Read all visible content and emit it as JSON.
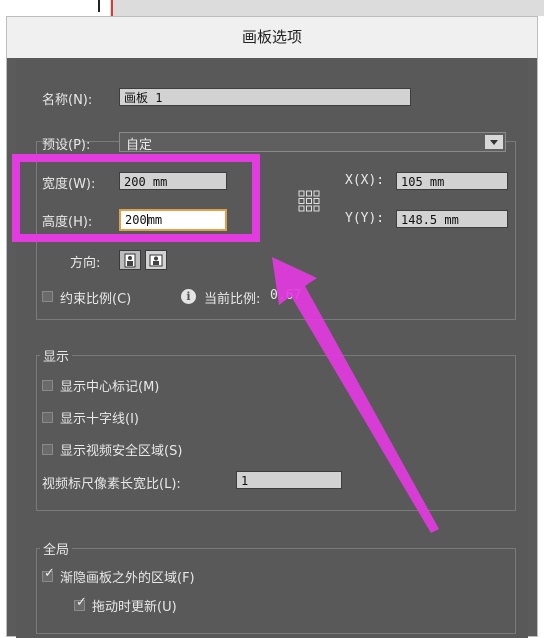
{
  "dialog": {
    "title": "画板选项",
    "name_label": "名称(N):",
    "name_value": "画板 1",
    "preset_label": "预设(P):",
    "preset_value": "自定",
    "width_label": "宽度(W):",
    "width_value": "200 mm",
    "height_label": "高度(H):",
    "height_value": "200mm",
    "x_label": "X(X):",
    "x_value": "105 mm",
    "y_label": "Y(Y):",
    "y_value": "148.5 mm",
    "orientation_label": "方向:",
    "constrain_label": "约束比例(C)",
    "constrain_checked": false,
    "current_ratio_label": "当前比例:",
    "current_ratio_value": "0.67",
    "display_group_label": "显示",
    "show_center_label": "显示中心标记(M)",
    "show_crosshairs_label": "显示十字线(I)",
    "show_video_safe_label": "显示视频安全区域(S)",
    "pixel_ratio_label": "视频标尺像素长宽比(L):",
    "pixel_ratio_value": "1",
    "global_group_label": "全局",
    "fade_outside_label": "渐隐画板之外的区域(F)",
    "fade_outside_checked": true,
    "update_drag_label": "拖动时更新(U)",
    "update_drag_checked": true
  },
  "colors": {
    "highlight": "#e23be0",
    "focus_border": "#e0a04a",
    "dialog_bg": "#595959"
  }
}
